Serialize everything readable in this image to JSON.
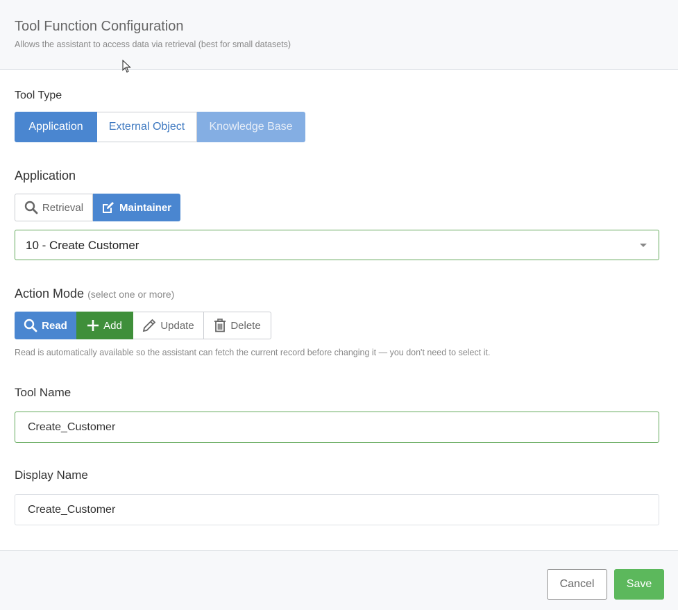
{
  "header": {
    "title": "Tool Function Configuration",
    "subtitle": "Allows the assistant to access data via retrieval (best for small datasets)"
  },
  "tool_type": {
    "label": "Tool Type",
    "options": [
      "Application",
      "External Object",
      "Knowledge Base"
    ],
    "selected": "Application"
  },
  "application": {
    "label": "Application",
    "modes": [
      "Retrieval",
      "Maintainer"
    ],
    "selected_mode": "Maintainer",
    "selected_app": "10 - Create Customer"
  },
  "action_mode": {
    "label": "Action Mode",
    "hint": "(select one or more)",
    "options": [
      "Read",
      "Add",
      "Update",
      "Delete"
    ],
    "selected": [
      "Read",
      "Add"
    ],
    "note": "Read is automatically available so the assistant can fetch the current record before changing it — you don't need to select it."
  },
  "tool_name": {
    "label": "Tool Name",
    "value": "Create_Customer"
  },
  "display_name": {
    "label": "Display Name",
    "value": "Create_Customer"
  },
  "footer": {
    "cancel_label": "Cancel",
    "save_label": "Save"
  },
  "colors": {
    "primary_blue": "#4a86d0",
    "disabled_blue": "#84aee3",
    "active_green": "#3f8f3a",
    "save_green": "#5cb85c",
    "focus_border_green": "#62a85a"
  }
}
